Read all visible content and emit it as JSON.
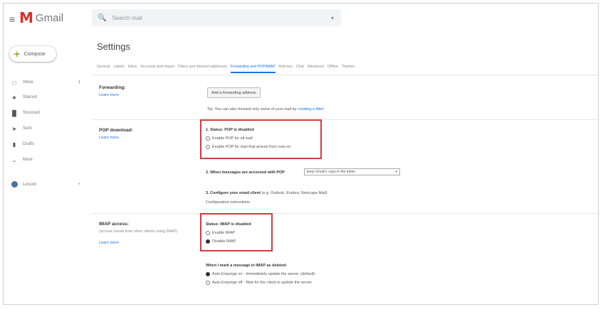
{
  "app": {
    "brand": "Gmail"
  },
  "search": {
    "placeholder": "Search mail"
  },
  "sidebar": {
    "compose_label": "Compose",
    "items": [
      {
        "label": "Inbox",
        "icon": "inbox-icon",
        "count": "1"
      },
      {
        "label": "Starred",
        "icon": "star-icon"
      },
      {
        "label": "Snoozed",
        "icon": "clock-icon"
      },
      {
        "label": "Sent",
        "icon": "send-icon"
      },
      {
        "label": "Drafts",
        "icon": "draft-icon"
      },
      {
        "label": "More",
        "icon": "chevron-down-icon"
      }
    ],
    "account": {
      "label": "Lesson",
      "add": "+"
    }
  },
  "settings": {
    "title": "Settings",
    "tabs": [
      "General",
      "Labels",
      "Inbox",
      "Accounts and Import",
      "Filters and blocked addresses",
      "Forwarding and POP/IMAP",
      "Add-ons",
      "Chat",
      "Advanced",
      "Offline",
      "Themes"
    ],
    "active_tab": 5,
    "forwarding": {
      "label": "Forwarding:",
      "learn_more": "Learn more",
      "button": "Add a forwarding address",
      "tip_prefix": "Tip: You can also forward only some of your mail by",
      "tip_link": "creating a filter!"
    },
    "pop": {
      "label": "POP download:",
      "learn_more": "Learn more",
      "status": "1. Status: POP is disabled",
      "opt_all": "Enable POP for all mail",
      "opt_now": "Enable POP for mail that arrives from now on",
      "step2": "2. When messages are accessed with POP",
      "step2_select": "keep Gmail's copy in the Inbox",
      "step3": "3. Configure your email client",
      "step3_tail": "(e.g. Outlook, Eudora, Netscape Mail)",
      "config_link": "Configuration instructions"
    },
    "imap": {
      "label": "IMAP access:",
      "sub": "(access Gmail from other clients using IMAP)",
      "learn_more": "Learn more",
      "status": "Status: IMAP is disabled",
      "opt_enable": "Enable IMAP",
      "opt_disable": "Disable IMAP",
      "deleted_title": "When I mark a message in IMAP as deleted:",
      "opt_auto_on": "Auto-Expunge on - Immediately update the server. (default)",
      "opt_auto_off": "Auto-Expunge off - Wait for the client to update the server."
    }
  },
  "colors": {
    "accent": "#1a73e8",
    "highlight_box": "#d53a3a",
    "gmail_red": "#d93025"
  }
}
